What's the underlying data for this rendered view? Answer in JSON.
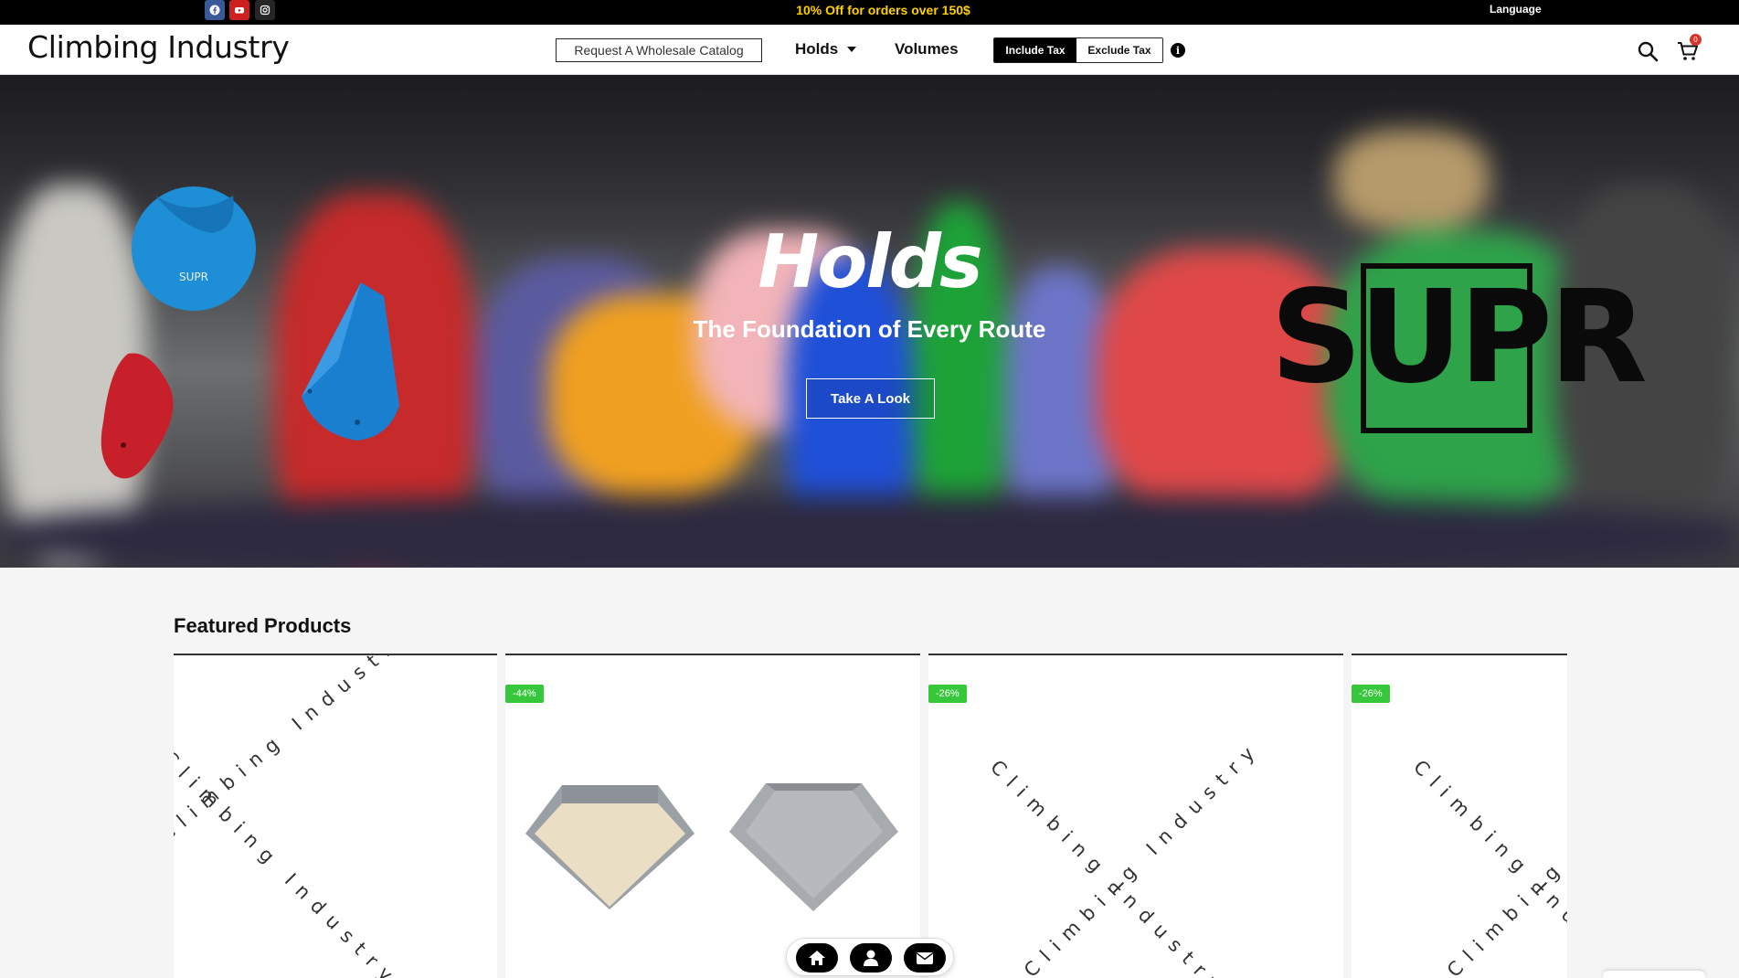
{
  "topbar": {
    "promo": "10% Off for orders over 150$",
    "language": "Language",
    "social": [
      {
        "icon": "facebook-icon",
        "color": "#3b5998"
      },
      {
        "icon": "youtube-icon",
        "color": "#cd201f"
      },
      {
        "icon": "instagram-icon",
        "color": "#262626"
      }
    ]
  },
  "header": {
    "logo": "Climbing Industry",
    "catalog_button": "Request A Wholesale Catalog",
    "nav": {
      "holds": "Holds",
      "volumes": "Volumes"
    },
    "tax": {
      "include": "Include Tax",
      "exclude": "Exclude Tax",
      "info": "i"
    },
    "cart_count": "0"
  },
  "hero": {
    "title": "Holds",
    "subtitle": "The Foundation of Every Route",
    "cta": "Take A Look",
    "brand": "SUPR",
    "hold_brand": "SUPR"
  },
  "featured": {
    "title": "Featured Products",
    "products": [
      {
        "discount": "",
        "watermark": "Climbing Industry"
      },
      {
        "discount": "-44%",
        "watermark": ""
      },
      {
        "discount": "-26%",
        "watermark": "Climbing Industry"
      },
      {
        "discount": "-26%",
        "watermark": "Climbing Industry"
      }
    ]
  },
  "colors": {
    "accent": "#000000",
    "promo": "#ffd000",
    "discount": "#36c73a",
    "badge": "#d8342b"
  }
}
